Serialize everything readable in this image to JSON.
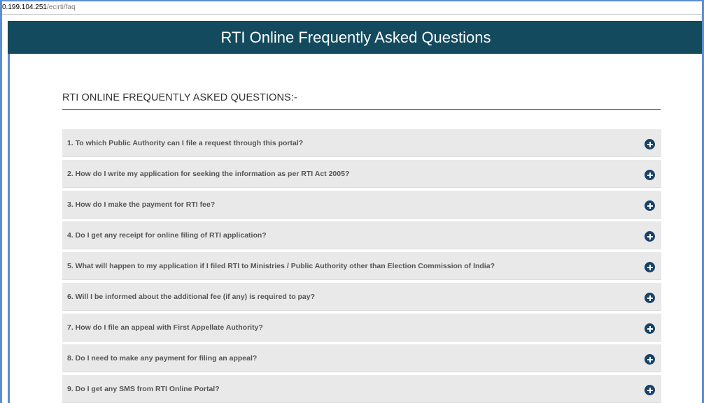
{
  "browser": {
    "url_host": "0.199.104.251",
    "url_path": "/ecirti/faq"
  },
  "header": {
    "title": "RTI Online Frequently Asked Questions"
  },
  "main": {
    "section_title": "RTI ONLINE FREQUENTLY ASKED QUESTIONS:-",
    "faq_icon": "plus-circle-icon",
    "faqs": [
      {
        "question": "1. To which Public Authority can I file a request through this portal?"
      },
      {
        "question": "2. How do I write my application for seeking the information as per RTI Act 2005?"
      },
      {
        "question": "3. How do I make the payment for RTI fee?"
      },
      {
        "question": "4. Do I get any receipt for online filing of RTI application?"
      },
      {
        "question": "5. What will happen to my application if I filed RTI to Ministries / Public Authority other than Election Commission of India?"
      },
      {
        "question": "6. Will I be informed about the additional fee (if any) is required to pay?"
      },
      {
        "question": "7. How do I file an appeal with First Appellate Authority?"
      },
      {
        "question": "8. Do I need to make any payment for filing an appeal?"
      },
      {
        "question": "9. Do I get any SMS from RTI Online Portal?"
      }
    ]
  },
  "colors": {
    "header_bg": "#134a5e",
    "accent_border": "#5a8fd0",
    "faq_bg": "#e9e9e9",
    "icon_bg": "#17426a"
  }
}
